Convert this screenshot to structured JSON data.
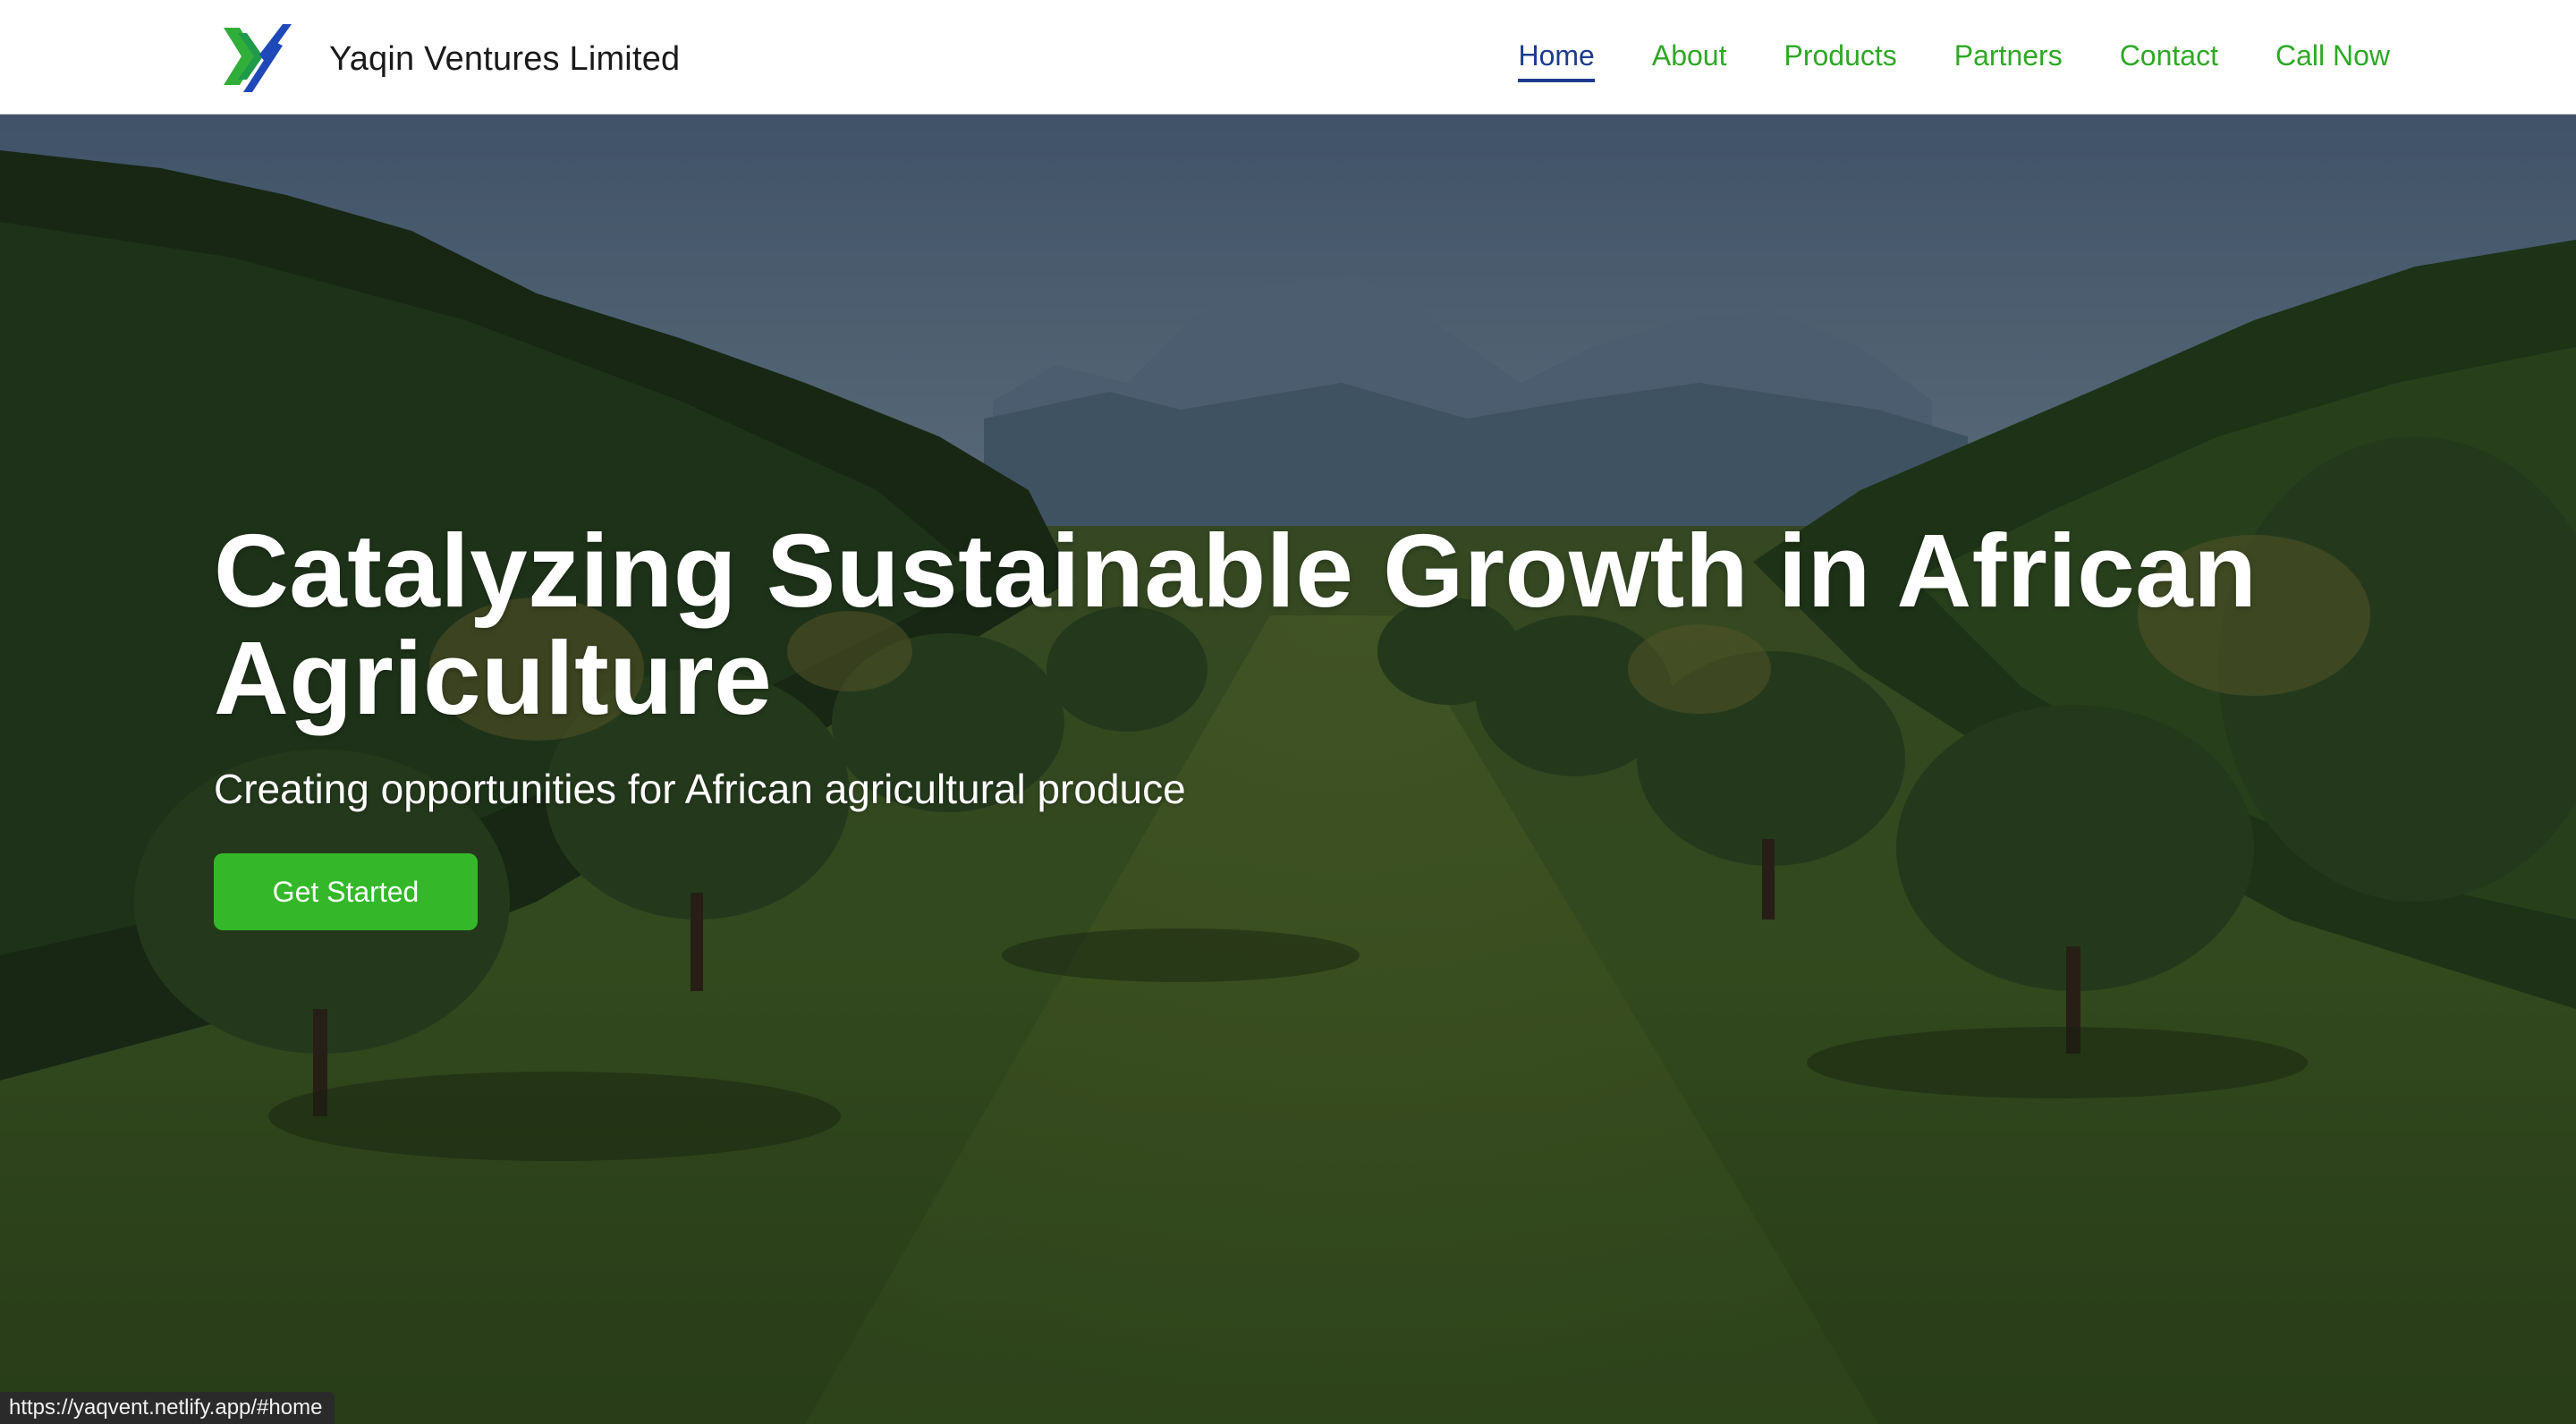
{
  "header": {
    "brand_name": "Yaqin Ventures Limited",
    "logo_icon": "yaqin-chevron-logo-icon",
    "nav": [
      {
        "label": "Home",
        "active": true
      },
      {
        "label": "About",
        "active": false
      },
      {
        "label": "Products",
        "active": false
      },
      {
        "label": "Partners",
        "active": false
      },
      {
        "label": "Contact",
        "active": false
      },
      {
        "label": "Call Now",
        "active": false
      }
    ]
  },
  "hero": {
    "title": "Catalyzing Sustainable Growth in African Agriculture",
    "subtitle": "Creating opportunities for African agricultural produce",
    "cta_label": "Get Started",
    "background": "mango-orchard-with-mountains-photo"
  },
  "status_bar": {
    "url": "https://yaqvent.netlify.app/#home"
  },
  "colors": {
    "accent_green": "#34b82a",
    "nav_green": "#2ea826",
    "active_blue": "#1d3c8f",
    "header_bg": "#ffffff"
  }
}
